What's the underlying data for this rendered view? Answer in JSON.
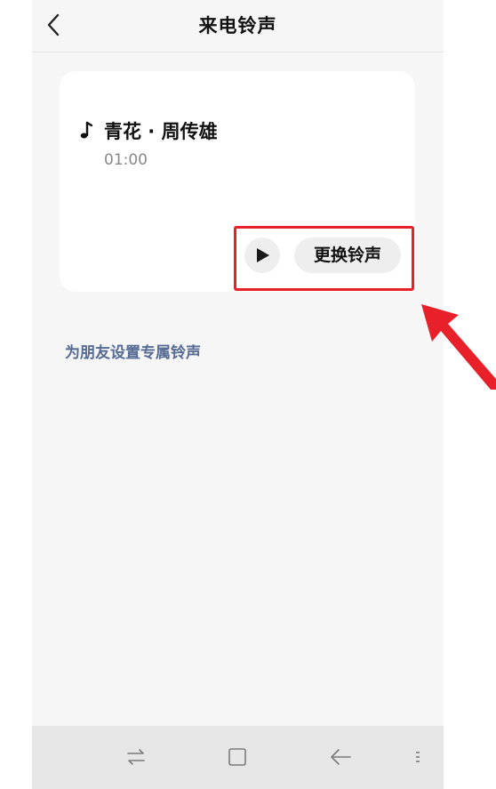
{
  "header": {
    "title": "来电铃声",
    "back_icon": "chevron-left-icon"
  },
  "ringtone": {
    "note_icon": "music-note-icon",
    "title": "青花 · 周传雄",
    "duration": "01:00",
    "play_icon": "play-icon",
    "change_label": "更换铃声"
  },
  "friend_link": {
    "label": "为朋友设置专属铃声",
    "color": "#566b94"
  },
  "navbar": {
    "items": [
      "swap-arrows-icon",
      "square-home-icon",
      "back-arrow-icon",
      "menu-dots-icon"
    ]
  },
  "annotation": {
    "color": "#e8202a",
    "items": [
      "highlight-box",
      "pointer-arrow"
    ]
  }
}
